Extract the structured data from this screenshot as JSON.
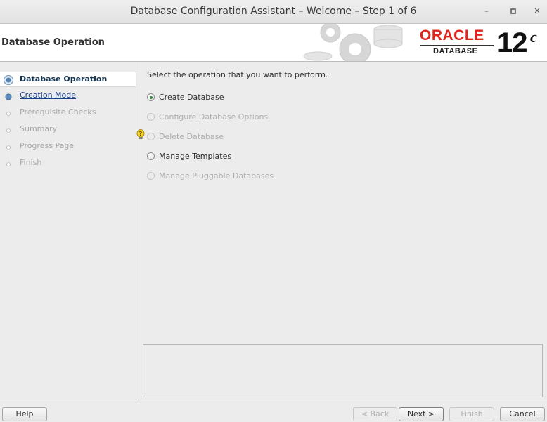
{
  "window": {
    "title": "Database Configuration Assistant – Welcome – Step 1 of 6",
    "minimize_glyph": "–",
    "maximize_glyph": "▫",
    "close_glyph": "✕"
  },
  "header": {
    "page_title": "Database Operation",
    "logo_text": "ORACLE",
    "logo_sub": "DATABASE",
    "version": "12",
    "version_sup": "c",
    "brand_color": "#e0251b"
  },
  "steps": [
    {
      "label": "Database Operation",
      "state": "current"
    },
    {
      "label": "Creation Mode",
      "state": "link"
    },
    {
      "label": "Prerequisite Checks",
      "state": "disabled"
    },
    {
      "label": "Summary",
      "state": "disabled"
    },
    {
      "label": "Progress Page",
      "state": "disabled"
    },
    {
      "label": "Finish",
      "state": "disabled"
    }
  ],
  "main": {
    "instruction": "Select the operation that you want to perform.",
    "options": [
      {
        "label": "Create Database",
        "selected": true,
        "enabled": true
      },
      {
        "label": "Configure Database Options",
        "selected": false,
        "enabled": false
      },
      {
        "label": "Delete Database",
        "selected": false,
        "enabled": false
      },
      {
        "label": "Manage Templates",
        "selected": false,
        "enabled": true
      },
      {
        "label": "Manage Pluggable Databases",
        "selected": false,
        "enabled": false
      }
    ],
    "hint_icon": "lightbulb-hint-icon"
  },
  "footer": {
    "help": "Help",
    "back": "< Back",
    "next": "Next >",
    "finish": "Finish",
    "cancel": "Cancel"
  }
}
